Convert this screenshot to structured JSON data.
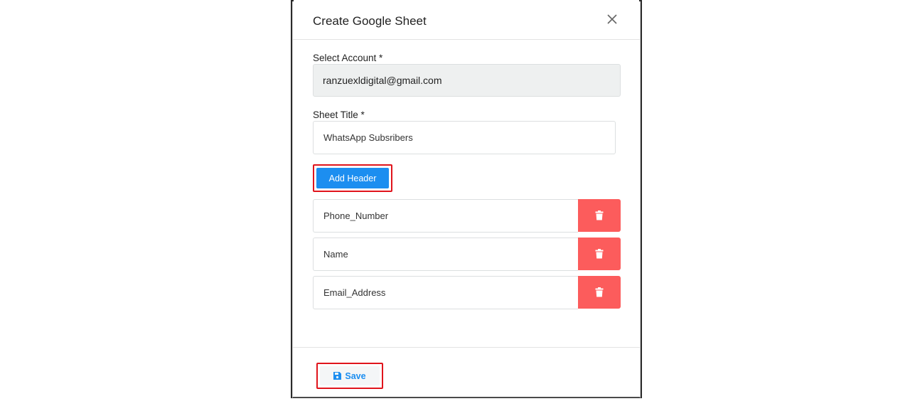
{
  "modal": {
    "title": "Create Google Sheet",
    "close_icon": "close-icon"
  },
  "form": {
    "account_label": "Select Account *",
    "account_value": "ranzuexldigital@gmail.com",
    "sheet_title_label": "Sheet Title *",
    "sheet_title_value": "WhatsApp Subsribers",
    "add_header_label": "Add Header",
    "headers": [
      {
        "value": "Phone_Number",
        "delete_icon": "trash-icon"
      },
      {
        "value": "Name",
        "delete_icon": "trash-icon"
      },
      {
        "value": "Email_Address",
        "delete_icon": "trash-icon"
      }
    ]
  },
  "footer": {
    "save_label": "Save",
    "save_icon": "floppy-disk-icon"
  },
  "colors": {
    "primary": "#1c8ef0",
    "danger": "#fc5c5c",
    "highlight": "#e0141c",
    "select_bg": "#eef0f0"
  }
}
